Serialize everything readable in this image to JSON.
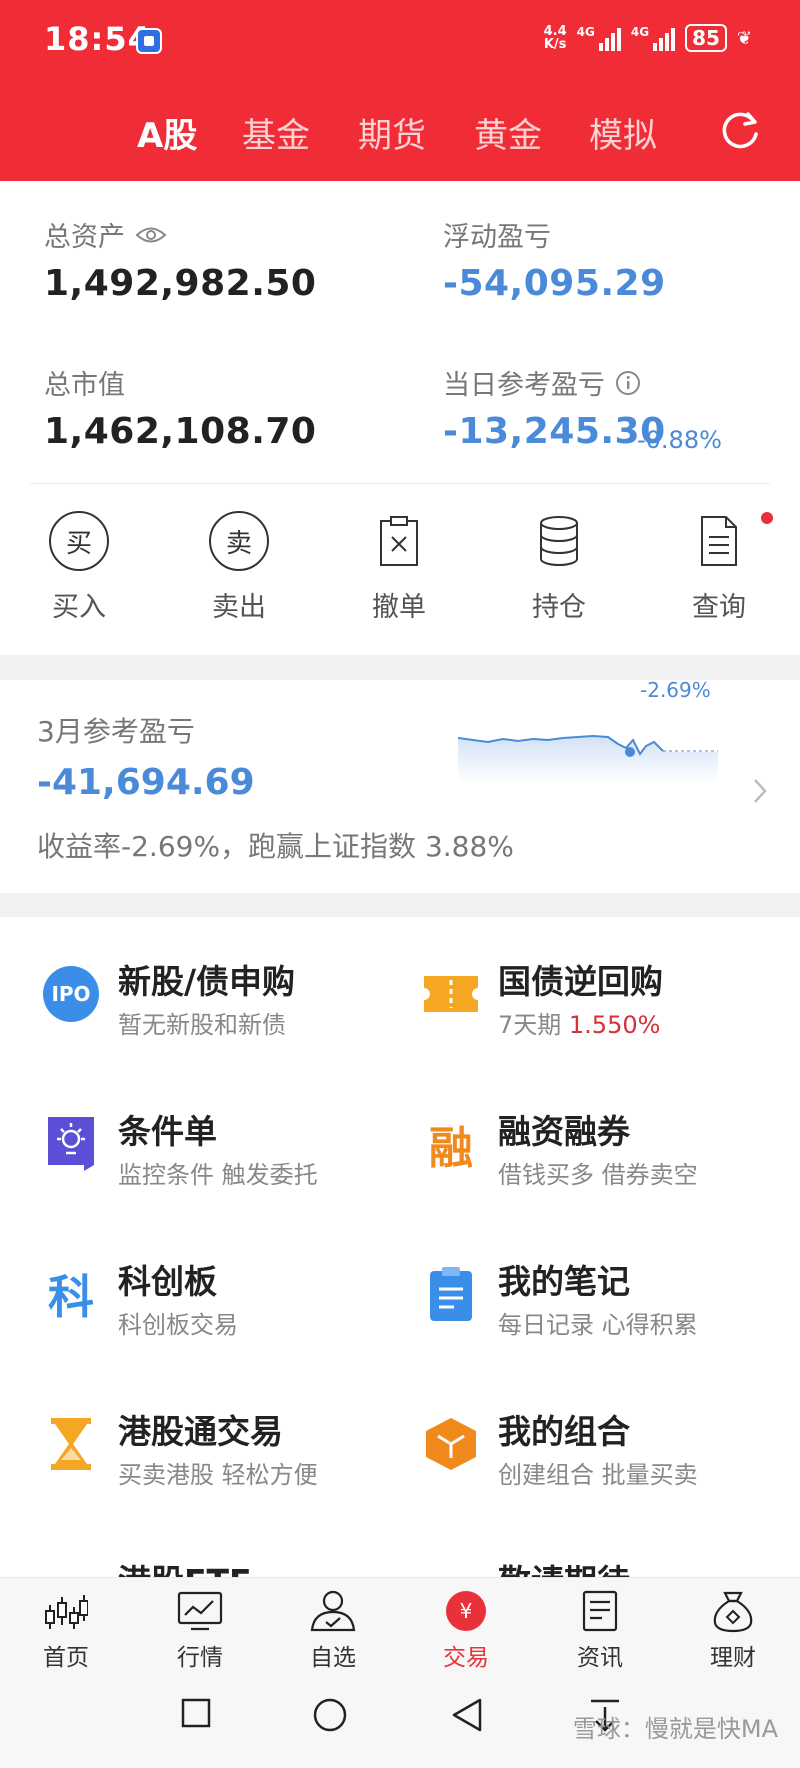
{
  "status_bar": {
    "time": "18:54",
    "net_speed_value": "4.4",
    "net_speed_unit": "K/s",
    "signal1": "4G",
    "signal2": "4G",
    "battery": "85"
  },
  "top_tabs": [
    {
      "label": "A股",
      "active": true
    },
    {
      "label": "基金",
      "active": false
    },
    {
      "label": "期货",
      "active": false
    },
    {
      "label": "黄金",
      "active": false
    },
    {
      "label": "模拟",
      "active": false
    }
  ],
  "assets": {
    "total_assets_label": "总资产",
    "total_assets_value": "1,492,982.50",
    "floating_pnl_label": "浮动盈亏",
    "floating_pnl_value": "-54,095.29",
    "market_value_label": "总市值",
    "market_value_value": "1,462,108.70",
    "daily_pnl_label": "当日参考盈亏",
    "daily_pnl_value": "-13,245.30",
    "daily_pnl_pct": "-0.88%"
  },
  "actions": [
    {
      "label": "买入",
      "glyph": "买"
    },
    {
      "label": "卖出",
      "glyph": "卖"
    },
    {
      "label": "撤单"
    },
    {
      "label": "持仓"
    },
    {
      "label": "查询"
    }
  ],
  "monthly": {
    "title": "3月参考盈亏",
    "value": "-41,694.69",
    "desc": "收益率-2.69%，跑赢上证指数 3.88%",
    "spark_label": "-2.69%"
  },
  "services": [
    {
      "title": "新股/债申购",
      "subtitle": "暂无新股和新债",
      "icon": "ipo-icon",
      "icon_text": "IPO"
    },
    {
      "title": "国债逆回购",
      "subtitle_prefix": "7天期 ",
      "subtitle_rate": "1.550%",
      "icon": "ticket-icon"
    },
    {
      "title": "条件单",
      "subtitle": "监控条件 触发委托",
      "icon": "bulb-icon"
    },
    {
      "title": "融资融券",
      "subtitle": "借钱买多 借券卖空",
      "icon": "margin-icon",
      "icon_text": "融"
    },
    {
      "title": "科创板",
      "subtitle": "科创板交易",
      "icon": "star-board-icon",
      "icon_text": "科"
    },
    {
      "title": "我的笔记",
      "subtitle": "每日记录 心得积累",
      "icon": "clipboard-icon"
    },
    {
      "title": "港股通交易",
      "subtitle": "买卖港股 轻松方便",
      "icon": "hourglass-icon"
    },
    {
      "title": "我的组合",
      "subtitle": "创建组合 批量买卖",
      "icon": "cube-icon"
    },
    {
      "title": "港股ETF",
      "icon": "etf-icon"
    },
    {
      "title": "敬请期待",
      "icon": "coming-soon-icon"
    }
  ],
  "bottom_nav": [
    {
      "label": "首页",
      "active": false
    },
    {
      "label": "行情",
      "active": false
    },
    {
      "label": "自选",
      "active": false
    },
    {
      "label": "交易",
      "active": true,
      "badge": "¥"
    },
    {
      "label": "资讯",
      "active": false
    },
    {
      "label": "理财",
      "active": false
    }
  ],
  "watermark": "雪球：慢就是快MA",
  "colors": {
    "header_red": "#f02d37",
    "loss_blue": "#4a8ad8",
    "rate_red": "#d6303a",
    "active_red": "#e8313a"
  }
}
